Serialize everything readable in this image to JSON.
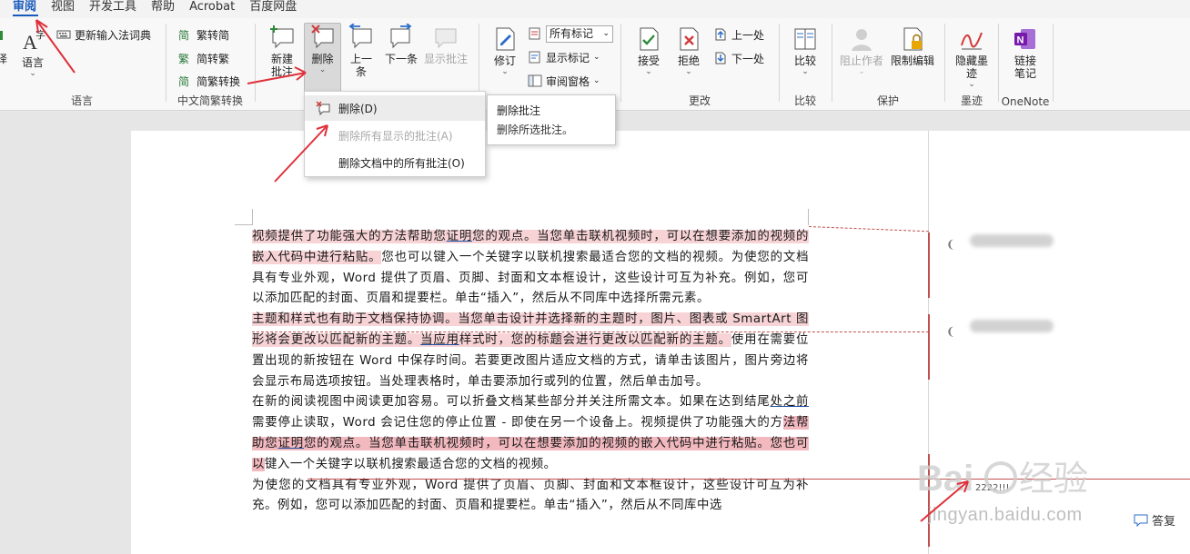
{
  "tabs": [
    "审阅",
    "视图",
    "开发工具",
    "帮助",
    "Acrobat",
    "百度网盘"
  ],
  "ribbon": {
    "lang_group": {
      "label": "语言",
      "big": "语言",
      "update_ime": "更新输入法词典",
      "left_partial": "译"
    },
    "chinese_group": {
      "label": "中文简繁转换",
      "to_simplified": "繁转简",
      "to_traditional": "简转繁",
      "convert": "简繁转换"
    },
    "comment_group": {
      "new": "新建\n批注",
      "delete": "删除",
      "prev": "上一条",
      "next": "下一条",
      "show": "显示批注"
    },
    "tracking": {
      "track": "修订",
      "markup": "所有标记",
      "show_markup": "显示标记",
      "pane": "审阅窗格"
    },
    "changes_group": {
      "label": "更改",
      "accept": "接受",
      "reject": "拒绝",
      "prev": "上一处",
      "next": "下一处"
    },
    "compare_group": {
      "label": "比较",
      "compare": "比较"
    },
    "protect_group": {
      "label": "保护",
      "block_authors": "阻止作者",
      "restrict": "限制编辑"
    },
    "ink_group": {
      "label": "墨迹",
      "hide_ink": "隐藏墨\n迹"
    },
    "onenote_group": {
      "label": "OneNote",
      "linked": "链接\n笔记"
    }
  },
  "delete_menu": {
    "items": [
      {
        "label": "删除(D)",
        "enabled": true
      },
      {
        "label": "删除所有显示的批注(A)",
        "enabled": false
      },
      {
        "label": "删除文档中的所有批注(O)",
        "enabled": true
      }
    ]
  },
  "tooltip": {
    "title": "删除批注",
    "desc": "删除所选批注。"
  },
  "document": {
    "p1": [
      "视频提供了功能强大的方法帮助您",
      "证明",
      "您的观点。当您单击联机视频时，可以在想要添加的视频的嵌入代码中进行粘贴。",
      "您也可以键入一个关键字以联机搜索最适合您的文档的视频。为使您的文档具有专业外观，Word 提供了页眉、页脚、封面和文本框设计，这些设计可互为补充。例如，您可以添加匹配的封面、页眉和提要栏。单击“插入”，然后从不同库中选择所需元素。"
    ],
    "p2": [
      "主题和样式也有助于文档保持协调。当您单击设计并选择新的主题时，图片、图表或 SmartArt 图形将会更改以匹配新的主题。",
      "当应用",
      "样式时，您的标题会进行更改以匹配新的主题。",
      "使用在需要位置出现的新按钮在 Word 中保存时间。若要更改图片适应文档的方式，请单击该图片，图片旁边将会显示布局选项按钮。当处理表格时，单击要添加行或列的位置，然后单击加号。"
    ],
    "p3": [
      "在新的阅读视图中阅读更加容易。可以折叠文档某些部分并关注所需文本。如果在达到结尾",
      "处之前",
      "需要停止读取，Word 会记住您的停止位置 - 即使在另一个设备上。视频提供了功能强大的方",
      "法帮助您",
      "证明",
      "您的观点。当您单击联机视频时，可以在想要添加的视频的嵌入代码中进行粘贴。您也可以",
      "键入一个关键字以联机搜索最适合您的文档的视频。"
    ],
    "p4": "为使您的文档具有专业外观，Word 提供了页眉、页脚、封面和文本框设计，这些设计可互为补充。例如，您可以添加匹配的封面、页眉和提要栏。单击“插入”，然后从不同库中选"
  },
  "margin": {
    "small_comment": "2222!!!",
    "reply": "答复"
  },
  "watermark": {
    "brand": "Bai du 经验",
    "url": "jingyan.baidu.com"
  },
  "colors": {
    "accent": "#185abd",
    "annotation_red": "#e0303a",
    "comment_red": "#c0504d",
    "highlight": "#f7d3d6"
  }
}
